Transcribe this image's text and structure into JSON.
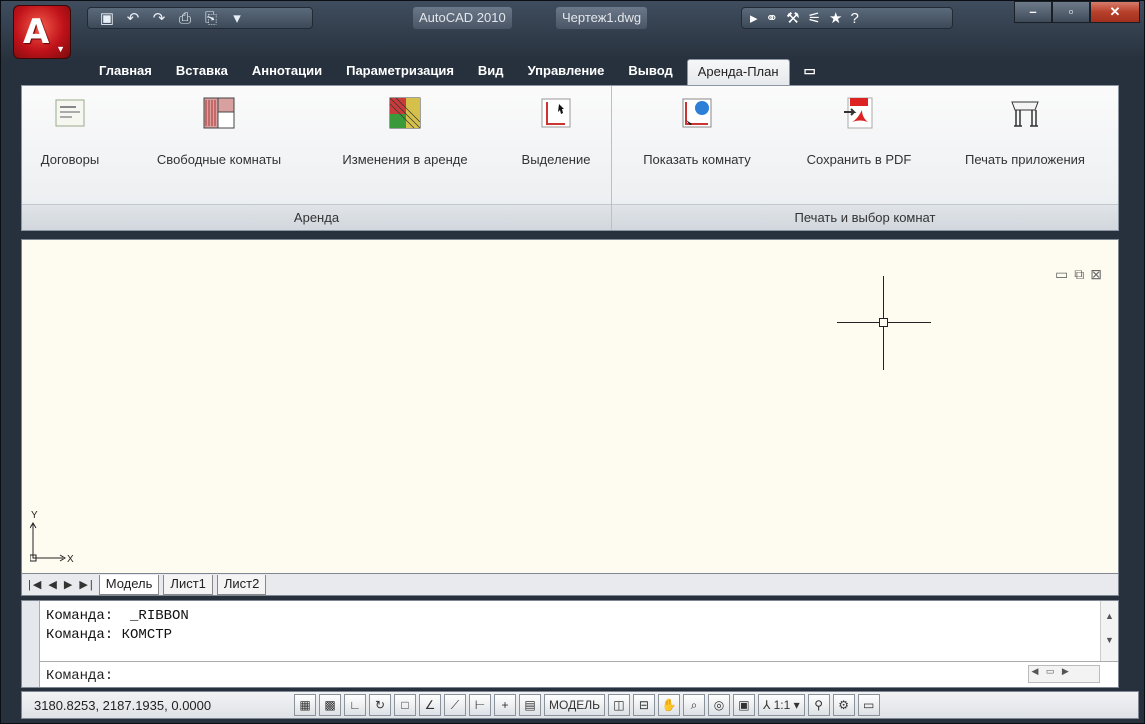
{
  "title_bar": {
    "app_name": "AutoCAD 2010",
    "file_name": "Чертеж1.dwg"
  },
  "ribbon_tabs": [
    "Главная",
    "Вставка",
    "Аннотации",
    "Параметризация",
    "Вид",
    "Управление",
    "Вывод",
    "Аренда-План"
  ],
  "active_tab": "Аренда-План",
  "panels": {
    "rent": {
      "title": "Аренда",
      "buttons": [
        "Договоры",
        "Свободные комнаты",
        "Изменения в аренде",
        "Выделение"
      ]
    },
    "print": {
      "title": "Печать и выбор комнат",
      "buttons": [
        "Показать комнату",
        "Сохранить в PDF",
        "Печать приложения"
      ]
    }
  },
  "drawing": {
    "ucs_x": "X",
    "ucs_y": "Y"
  },
  "layout_tabs": [
    "Модель",
    "Лист1",
    "Лист2"
  ],
  "command_line": {
    "history": [
      "Команда:  _RIBBON",
      "Команда: КОМСТР"
    ],
    "prompt": "Команда:"
  },
  "status_bar": {
    "coordinates": "3180.8253, 2187.1935, 0.0000",
    "model_label": "МОДЕЛЬ",
    "scale": "1:1"
  }
}
